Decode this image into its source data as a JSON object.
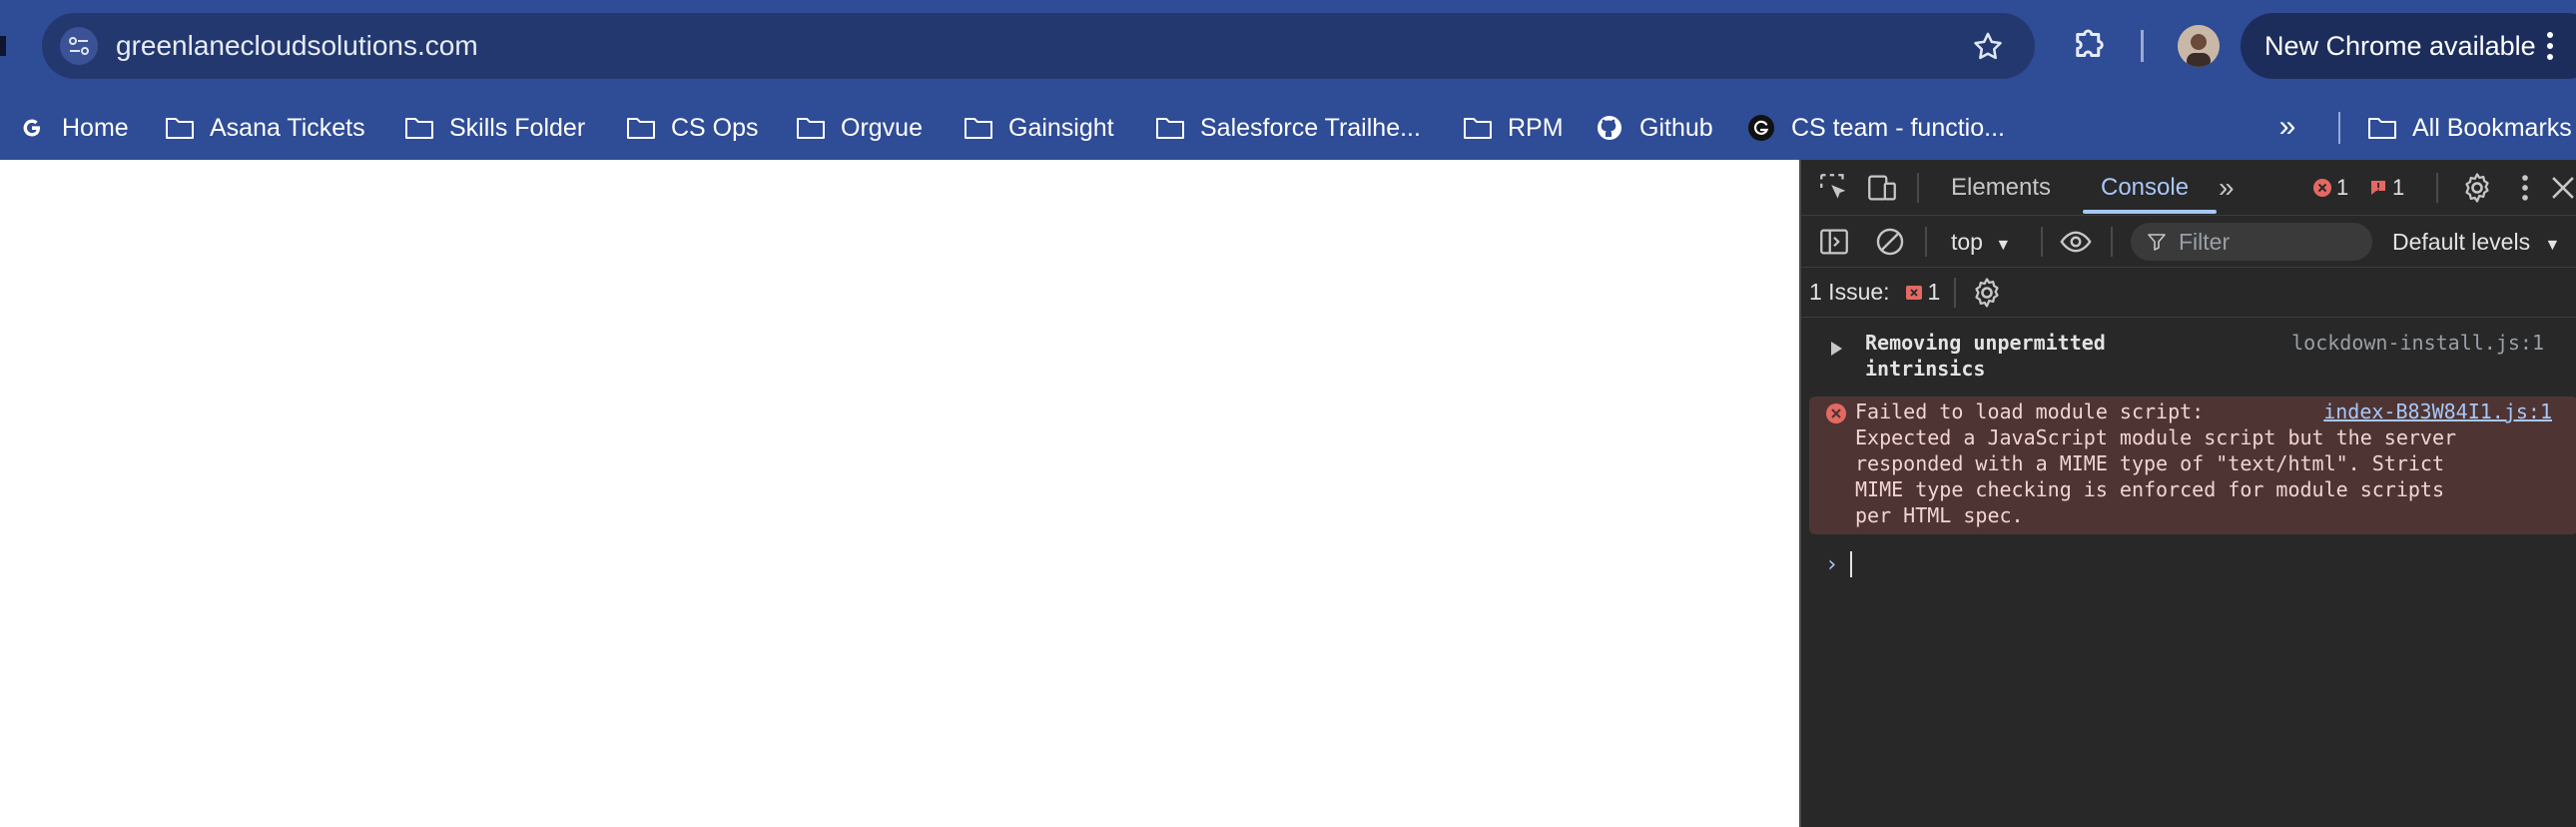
{
  "toolbar": {
    "url": "greenlanecloudsolutions.com",
    "update_label": "New Chrome available"
  },
  "bookmarks": [
    {
      "label": "Home",
      "icon": "google-icon"
    },
    {
      "label": "Asana Tickets",
      "icon": "folder-icon"
    },
    {
      "label": "Skills Folder",
      "icon": "folder-icon"
    },
    {
      "label": "CS Ops",
      "icon": "folder-icon"
    },
    {
      "label": "Orgvue",
      "icon": "folder-icon"
    },
    {
      "label": "Gainsight",
      "icon": "folder-icon"
    },
    {
      "label": "Salesforce Trailhe...",
      "icon": "folder-icon"
    },
    {
      "label": "RPM",
      "icon": "folder-icon"
    },
    {
      "label": "Github",
      "icon": "github-icon"
    },
    {
      "label": "CS team - functio...",
      "icon": "grammarly-icon"
    }
  ],
  "bookmarks_all": "All Bookmarks",
  "devtools": {
    "tabs": [
      {
        "label": "Elements",
        "active": false
      },
      {
        "label": "Console",
        "active": true
      }
    ],
    "error_count": "1",
    "warning_count": "1",
    "context": "top",
    "filter_placeholder": "Filter",
    "levels": "Default levels",
    "issues_label": "1 Issue:",
    "issues_count": "1",
    "messages": [
      {
        "type": "info",
        "text": "Removing unpermitted\nintrinsics",
        "source": "lockdown-install.js:1"
      },
      {
        "type": "error",
        "text": "Failed to load module script:\nExpected a JavaScript module script but the server\nresponded with a MIME type of \"text/html\". Strict\nMIME type checking is enforced for module scripts\nper HTML spec.",
        "source": "index-B83W84I1.js:1"
      }
    ]
  },
  "colors": {
    "chrome_bg": "#2f4c96",
    "devtools_bg": "#282828",
    "error_bg": "#4e3534",
    "accent": "#a8c7fa"
  }
}
